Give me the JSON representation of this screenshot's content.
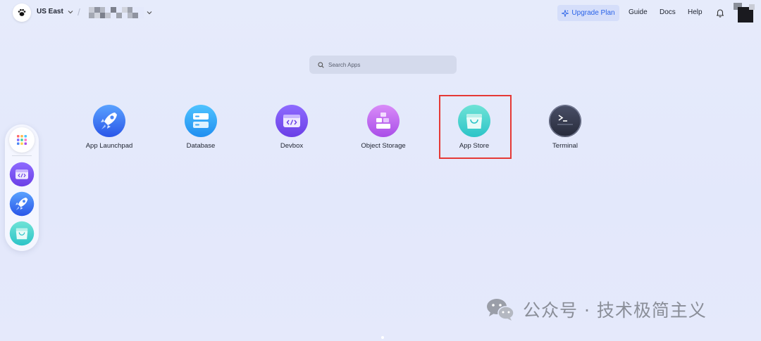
{
  "header": {
    "region": "US East",
    "workspace_separator": "/",
    "upgrade_label": "Upgrade Plan",
    "nav": [
      {
        "label": "Guide"
      },
      {
        "label": "Docs"
      },
      {
        "label": "Help"
      }
    ]
  },
  "search": {
    "placeholder": "Search Apps"
  },
  "apps": [
    {
      "label": "App Launchpad",
      "icon": "rocket-icon"
    },
    {
      "label": "Database",
      "icon": "database-icon"
    },
    {
      "label": "Devbox",
      "icon": "devbox-icon"
    },
    {
      "label": "Object Storage",
      "icon": "object-storage-icon"
    },
    {
      "label": "App Store",
      "icon": "shopping-bag-icon",
      "highlighted": true
    },
    {
      "label": "Terminal",
      "icon": "terminal-icon"
    }
  ],
  "dock": {
    "items": [
      {
        "icon": "launcher-grid-icon"
      },
      {
        "icon": "devbox-icon"
      },
      {
        "icon": "rocket-icon"
      },
      {
        "icon": "shopping-bag-icon"
      }
    ]
  },
  "watermark": {
    "text": "公众号 · 技术极简主义"
  },
  "colors": {
    "accent": "#2a63e8",
    "highlight_border": "#e53935",
    "background": "#e4e9fb"
  }
}
